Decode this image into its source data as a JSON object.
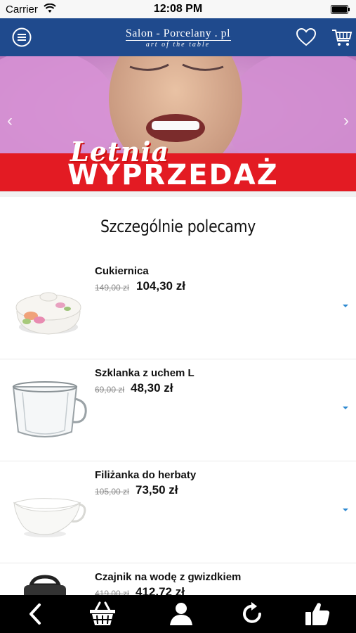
{
  "status_bar": {
    "carrier": "Carrier",
    "time": "12:08 PM"
  },
  "header": {
    "logo_main": "Salon - Porcelany . pl",
    "logo_sub": "art of the table",
    "background_color": "#1f4a8d"
  },
  "banner": {
    "title_line1": "Letnia",
    "title_line2": "WYPRZEDAŻ",
    "left_arrow": "‹",
    "right_arrow": "›",
    "ribbon_color": "#e31b23"
  },
  "section": {
    "title": "Szczególnie polecamy"
  },
  "products": [
    {
      "name": "Cukiernica",
      "old_price": "149,00 zł",
      "price": "104,30 zł",
      "icon": "sugar-bowl-icon"
    },
    {
      "name": "Szklanka z uchem L",
      "old_price": "69,00 zł",
      "price": "48,30 zł",
      "icon": "glass-cup-icon"
    },
    {
      "name": "Filiżanka do herbaty",
      "old_price": "105,00 zł",
      "price": "73,50 zł",
      "icon": "tea-cup-icon"
    },
    {
      "name": "Czajnik na wodę z gwizdkiem",
      "old_price": "419,00 zł",
      "price": "412,72 zł",
      "icon": "kettle-icon"
    }
  ],
  "tab_bar": {
    "items": [
      "back-icon",
      "basket-icon",
      "user-icon",
      "refresh-icon",
      "thumbs-up-icon"
    ]
  }
}
